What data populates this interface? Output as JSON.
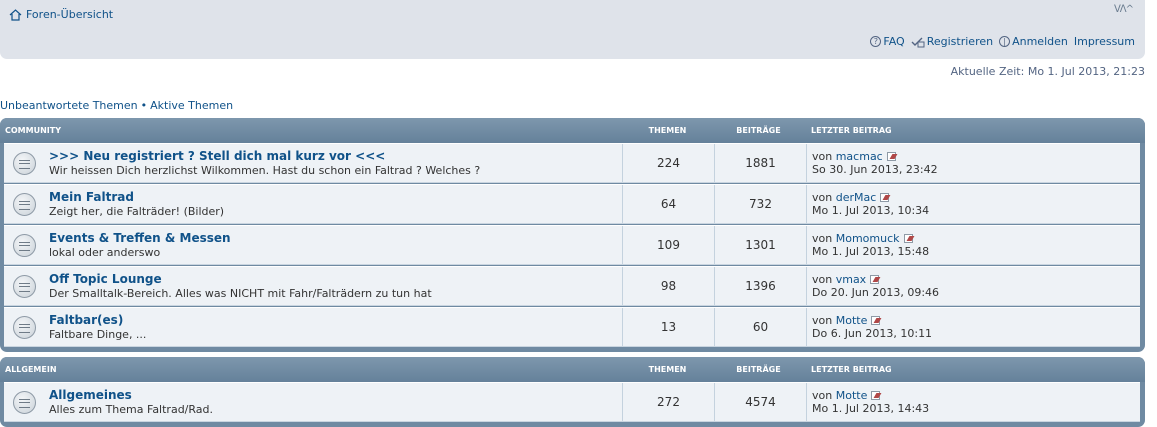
{
  "nav": {
    "home_label": "Foren-Übersicht",
    "font_size_glyph": "ᐯᐱ^",
    "faq_label": "FAQ",
    "register_label": "Registrieren",
    "login_label": "Anmelden",
    "impressum_label": "Impressum"
  },
  "current_time": "Aktuelle Zeit: Mo 1. Jul 2013, 21:23",
  "quicklinks": {
    "unanswered": "Unbeantwortete Themen",
    "separator": "•",
    "active": "Aktive Themen"
  },
  "categories": [
    {
      "name": "COMMUNITY",
      "col_topics": "THEMEN",
      "col_posts": "BEITRÄGE",
      "col_last": "LETZTER BEITRAG",
      "forums": [
        {
          "title": ">>> Neu registriert ? Stell dich mal kurz vor <<<",
          "description": "Wir heissen Dich herzlichst Wilkommen. Hast du schon ein Faltrad ? Welches ?",
          "topics": "224",
          "posts": "1881",
          "by": "von",
          "user": "macmac",
          "date": "So 30. Jun 2013, 23:42"
        },
        {
          "title": "Mein Faltrad",
          "description": "Zeigt her, die Falträder! (Bilder)",
          "topics": "64",
          "posts": "732",
          "by": "von",
          "user": "derMac",
          "date": "Mo 1. Jul 2013, 10:34"
        },
        {
          "title": "Events & Treffen & Messen",
          "description": "lokal oder anderswo",
          "topics": "109",
          "posts": "1301",
          "by": "von",
          "user": "Momomuck",
          "date": "Mo 1. Jul 2013, 15:48"
        },
        {
          "title": "Off Topic Lounge",
          "description": "Der Smalltalk-Bereich. Alles was NICHT mit Fahr/Falträdern zu tun hat",
          "topics": "98",
          "posts": "1396",
          "by": "von",
          "user": "vmax",
          "date": "Do 20. Jun 2013, 09:46"
        },
        {
          "title": "Faltbar(es)",
          "description": "Faltbare Dinge, ...",
          "topics": "13",
          "posts": "60",
          "by": "von",
          "user": "Motte",
          "date": "Do 6. Jun 2013, 10:11"
        }
      ]
    },
    {
      "name": "ALLGEMEIN",
      "col_topics": "THEMEN",
      "col_posts": "BEITRÄGE",
      "col_last": "LETZTER BEITRAG",
      "forums": [
        {
          "title": "Allgemeines",
          "description": "Alles zum Thema Faltrad/Rad.",
          "topics": "272",
          "posts": "4574",
          "by": "von",
          "user": "Motte",
          "date": "Mo 1. Jul 2013, 14:43"
        }
      ]
    }
  ]
}
